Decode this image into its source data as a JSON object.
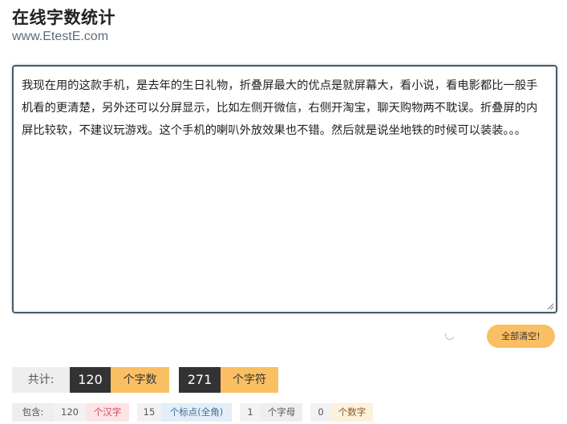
{
  "header": {
    "title": "在线字数统计",
    "url": "www.EtestE.com"
  },
  "editor": {
    "text": "我现在用的这款手机，是去年的生日礼物，折叠屏最大的优点是就屏幕大，看小说，看电影都比一般手机看的更清楚，另外还可以分屏显示，比如左侧开微信，右侧开淘宝，聊天购物两不耽误。折叠屏的内屏比较软，不建议玩游戏。这个手机的喇叭外放效果也不错。然后就是说坐地铁的时候可以装装。。。"
  },
  "actions": {
    "clear_label": "全部清空!"
  },
  "totals": {
    "label": "共计:",
    "word_count": "120",
    "word_unit": "个字数",
    "char_count": "271",
    "char_unit": "个字符"
  },
  "details": {
    "label": "包含:",
    "items": [
      {
        "count": "120",
        "unit": "个汉字"
      },
      {
        "count": "15",
        "unit": "个标点(全角)"
      },
      {
        "count": "1",
        "unit": "个字母"
      },
      {
        "count": "0",
        "unit": "个数字"
      }
    ]
  },
  "colors": {
    "accent": "#f9bf62",
    "dark_badge": "#333333",
    "editor_border": "#4a5a66"
  }
}
